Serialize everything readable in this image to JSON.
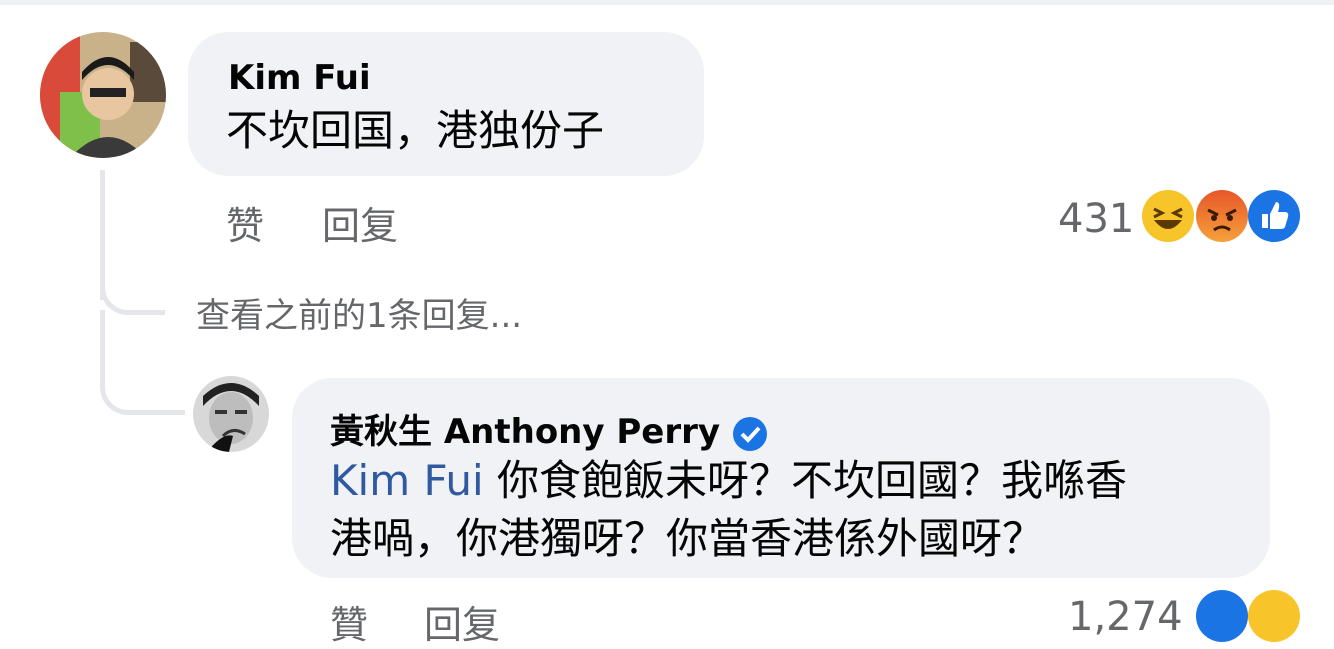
{
  "comment1": {
    "author": "Kim Fui",
    "text": "不坎回国，港独份子",
    "actions": {
      "like": "赞",
      "reply": "回复"
    },
    "reaction_count": "431",
    "reactions": [
      "haha-icon",
      "angry-icon",
      "like-icon"
    ]
  },
  "view_previous": "查看之前的1条回复...",
  "reply1": {
    "author": "黃秋生 Anthony Perry",
    "verified": true,
    "mention": "Kim Fui",
    "text_line1": " 你食飽飯未呀？不坎回國？我喺香",
    "text_line2": "港喎，你港獨呀？你當香港係外國呀？",
    "actions": {
      "like": "贊",
      "reply": "回复"
    },
    "reaction_count": "1,274"
  },
  "colors": {
    "bubble": "#f0f2f5",
    "mention": "#2f5a9f",
    "secondary": "#65676b",
    "thread": "#e4e6eb"
  }
}
